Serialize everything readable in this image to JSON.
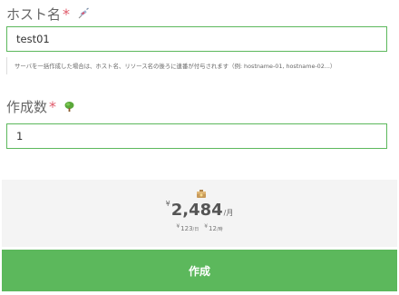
{
  "hostname": {
    "label": "ホスト名",
    "required_mark": "*",
    "icon": "syringe-icon",
    "value": "test01",
    "hint": "サーバを一括作成した場合は、ホスト名、リソース名の後ろに連番が付与されます（例: hostname-01, hostname-02...）"
  },
  "count": {
    "label": "作成数",
    "required_mark": "*",
    "icon": "tree-icon",
    "value": "1"
  },
  "price": {
    "icon": "coin-box-icon",
    "currency": "¥",
    "monthly": "2,484",
    "monthly_unit": "/月",
    "daily": "123",
    "daily_unit": "/日",
    "hourly": "12",
    "hourly_unit": "/時"
  },
  "actions": {
    "create_label": "作成"
  },
  "colors": {
    "accent": "#5cb85c",
    "required": "#e05a6a",
    "price_bg": "#f4f4f4"
  }
}
